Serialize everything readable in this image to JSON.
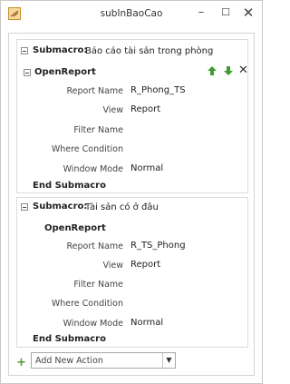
{
  "window": {
    "title": "subInBaoCao",
    "minimize_glyph": "–",
    "maximize_glyph": "☐",
    "close_glyph": "✕"
  },
  "submacro_1": {
    "keyword": "Submacro:",
    "name": "Báo cáo tài sản trong phòng",
    "action": {
      "name": "OpenReport",
      "delete_glyph": "✕",
      "args": [
        {
          "label": "Report Name",
          "value": "R_Phong_TS"
        },
        {
          "label": "View",
          "value": "Report"
        },
        {
          "label": "Filter Name",
          "value": ""
        },
        {
          "label": "Where Condition",
          "value": ""
        },
        {
          "label": "Window Mode",
          "value": "Normal"
        }
      ]
    },
    "end": "End Submacro"
  },
  "submacro_2": {
    "keyword": "Submacro:",
    "name": "Tài sản có ở đâu",
    "action": {
      "name": "OpenReport",
      "args": [
        {
          "label": "Report Name",
          "value": "R_TS_Phong"
        },
        {
          "label": "View",
          "value": "Report"
        },
        {
          "label": "Filter Name",
          "value": ""
        },
        {
          "label": "Where Condition",
          "value": ""
        },
        {
          "label": "Window Mode",
          "value": "Normal"
        }
      ]
    },
    "end": "End Submacro"
  },
  "add_action": {
    "plus_glyph": "+",
    "placeholder": "Add New Action",
    "dropdown_glyph": "▼"
  },
  "colors": {
    "arrow_green": "#3f9b2f",
    "add_green": "#4f9a2a"
  }
}
